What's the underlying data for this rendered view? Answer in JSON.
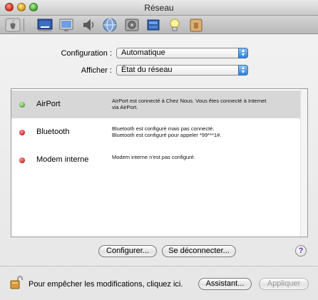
{
  "window": {
    "title": "Réseau"
  },
  "toolbar": {
    "icons": [
      "apple-icon",
      "display-icon",
      "screen-icon",
      "sound-icon",
      "network-icon",
      "disk-icon",
      "energy-icon",
      "lightbulb-icon",
      "security-icon"
    ]
  },
  "form": {
    "configuration_label": "Configuration :",
    "configuration_value": "Automatique",
    "afficher_label": "Afficher :",
    "afficher_value": "État du réseau"
  },
  "services": [
    {
      "name": "AirPort",
      "status": "green",
      "desc_line1": "AirPort est connecté à Chez Nous. Vous êtes connecté à Internet",
      "desc_line2": "via AirPort."
    },
    {
      "name": "Bluetooth",
      "status": "red",
      "desc_line1": "Bluetooth est configuré mais pas connecté.",
      "desc_line2": "Bluetooth est configuré pour appeler *99***1#."
    },
    {
      "name": "Modem interne",
      "status": "red",
      "desc_line1": "Modem interne n'est pas configuré.",
      "desc_line2": ""
    }
  ],
  "buttons": {
    "configurer": "Configurer...",
    "deconnecter": "Se déconnecter...",
    "help": "?",
    "assistant": "Assistant...",
    "appliquer": "Appliquer"
  },
  "lock_text": "Pour empêcher les modifications, cliquez ici.",
  "colors": {
    "accent": "#2f7fd8",
    "selected_row": "#d7d7d7",
    "status_green": "#4aa637",
    "status_red": "#cc2020"
  }
}
